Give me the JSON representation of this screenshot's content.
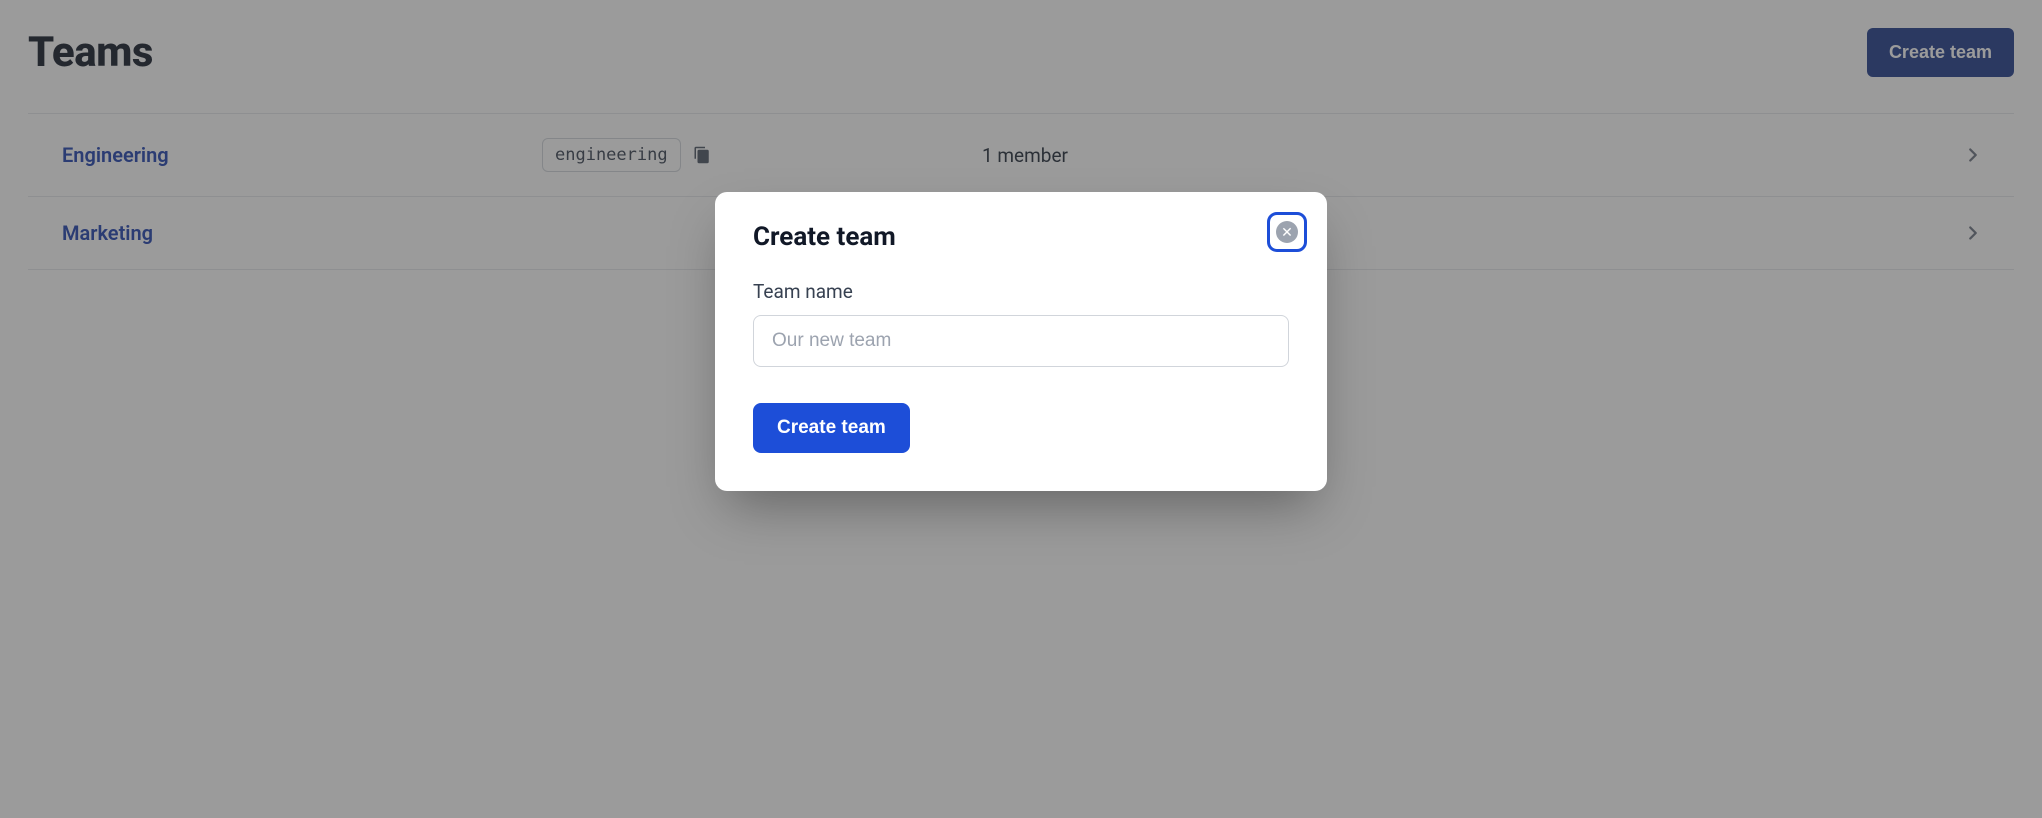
{
  "header": {
    "title": "Teams",
    "create_button": "Create team"
  },
  "teams": [
    {
      "name": "Engineering",
      "slug": "engineering",
      "members_text": "1 member"
    },
    {
      "name": "Marketing",
      "slug": "",
      "members_text": ""
    }
  ],
  "modal": {
    "title": "Create team",
    "field_label": "Team name",
    "placeholder": "Our new team",
    "value": "",
    "submit_label": "Create team",
    "close_glyph": "✕"
  },
  "colors": {
    "primary": "#1d4ed8",
    "primary_dark": "#1e3a8a",
    "text": "#111827"
  }
}
